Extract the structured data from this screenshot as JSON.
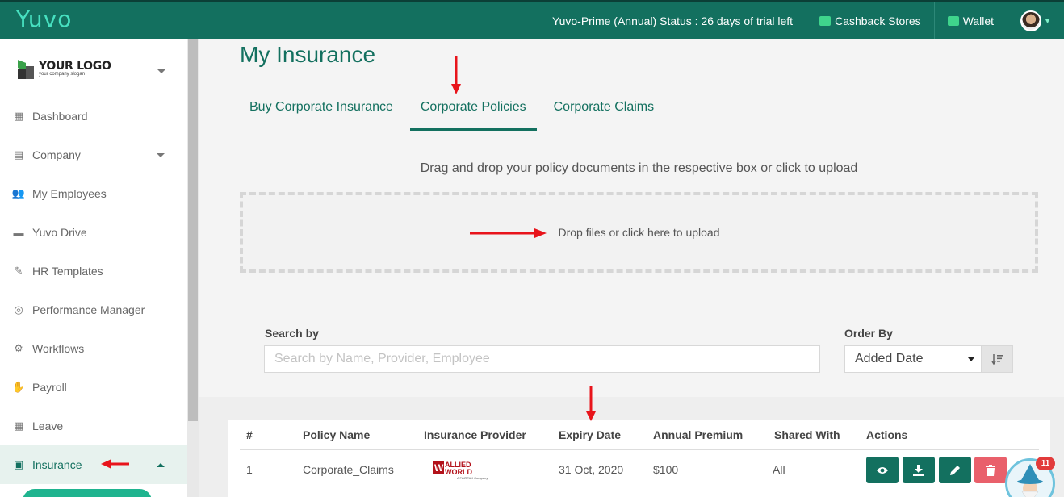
{
  "app": {
    "brand": "Yuvo"
  },
  "topbar": {
    "status": "Yuvo-Prime (Annual) Status : 26 days of trial left",
    "cashback": "Cashback Stores",
    "wallet": "Wallet",
    "accent": "#13705f"
  },
  "sidebar": {
    "logo_title": "YOUR LOGO",
    "logo_sub": "your company slogan",
    "items": [
      {
        "label": "Dashboard",
        "icon": "grid-icon"
      },
      {
        "label": "Company",
        "icon": "archive-icon"
      },
      {
        "label": "My Employees",
        "icon": "users-icon"
      },
      {
        "label": "Yuvo Drive",
        "icon": "folder-icon"
      },
      {
        "label": "HR Templates",
        "icon": "edit-icon"
      },
      {
        "label": "Performance Manager",
        "icon": "target-icon"
      },
      {
        "label": "Workflows",
        "icon": "gears-icon"
      },
      {
        "label": "Payroll",
        "icon": "hand-coins-icon"
      },
      {
        "label": "Leave",
        "icon": "calendar-icon"
      },
      {
        "label": "Insurance",
        "icon": "insurance-icon"
      }
    ]
  },
  "main": {
    "title": "My Insurance",
    "tabs": [
      "Buy Corporate Insurance",
      "Corporate Policies",
      "Corporate Claims"
    ],
    "hint": "Drag and drop your policy documents in the respective box or click to upload",
    "dropzone": "Drop files or click here to upload",
    "search_label": "Search by",
    "search_placeholder": "Search by Name, Provider, Employee",
    "order_label": "Order By",
    "order_value": "Added Date"
  },
  "table": {
    "headers": [
      "#",
      "Policy Name",
      "Insurance Provider",
      "Expiry Date",
      "Annual Premium",
      "Shared With",
      "Actions"
    ],
    "rows": [
      {
        "num": "1",
        "policy": "Corporate_Claims",
        "provider_logo": "ALLIED WORLD",
        "provider_sub": "A FAIRFAX Company",
        "expiry": "31 Oct, 2020",
        "premium": "$100",
        "shared": "All"
      }
    ]
  },
  "help": {
    "badge": "11"
  }
}
